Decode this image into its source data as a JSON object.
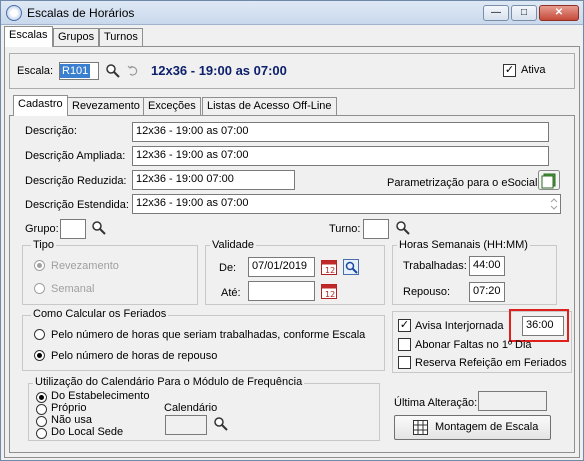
{
  "window": {
    "title": "Escalas de Horários"
  },
  "main_tabs": [
    "Escalas",
    "Grupos",
    "Turnos"
  ],
  "escala": {
    "label": "Escala:",
    "code": "R101",
    "name": "12x36 - 19:00 as 07:00",
    "ativa_label": "Ativa",
    "ativa_checked": true
  },
  "sub_tabs": [
    "Cadastro",
    "Revezamento",
    "Exceções",
    "Listas de Acesso Off-Line"
  ],
  "fields": {
    "descricao_label": "Descrição:",
    "descricao": "12x36 - 19:00 as 07:00",
    "ampliada_label": "Descrição Ampliada:",
    "ampliada": "12x36 - 19:00 as 07:00",
    "reduzida_label": "Descrição Reduzida:",
    "reduzida": "12x36 - 19:00 07:00",
    "estendida_label": "Descrição Estendida:",
    "estendida": "12x36 - 19:00 as 07:00",
    "esocial_label": "Parametrização para o eSocial:",
    "grupo_label": "Grupo:",
    "turno_label": "Turno:"
  },
  "tipo": {
    "legend": "Tipo",
    "options": [
      "Revezamento",
      "Semanal"
    ],
    "selected": "Revezamento"
  },
  "validade": {
    "legend": "Validade",
    "de_label": "De:",
    "de_value": "07/01/2019",
    "ate_label": "Até:",
    "ate_value": ""
  },
  "horas": {
    "legend": "Horas Semanais (HH:MM)",
    "trabalhadas_label": "Trabalhadas:",
    "trabalhadas": "44:00",
    "repouso_label": "Repouso:",
    "repouso": "07:20"
  },
  "feriados": {
    "legend": "Como Calcular os Feriados",
    "options": [
      "Pelo número de horas que seriam trabalhadas, conforme Escala",
      "Pelo número de horas de repouso"
    ],
    "selected": "Pelo número de horas de repouso"
  },
  "opcoes": {
    "avisa_label": "Avisa Interjornada",
    "avisa_checked": true,
    "avisa_value": "36:00",
    "abonar_label": "Abonar Faltas no 1º Dia",
    "reserva_label": "Reserva Refeição em Feriados"
  },
  "calendario": {
    "legend": "Utilização do Calendário Para o Módulo de Frequência",
    "options": [
      "Do Estabelecimento",
      "Próprio",
      "Não usa",
      "Do Local Sede"
    ],
    "selected": "Do Estabelecimento",
    "calendario_label": "Calendário"
  },
  "ultima_alteracao_label": "Última Alteração:",
  "montagem_button": "Montagem de Escala",
  "colors": {
    "highlight_border": "#e0201c",
    "code_bg": "#3b7fd1",
    "title_blue": "#0b1f6b"
  }
}
